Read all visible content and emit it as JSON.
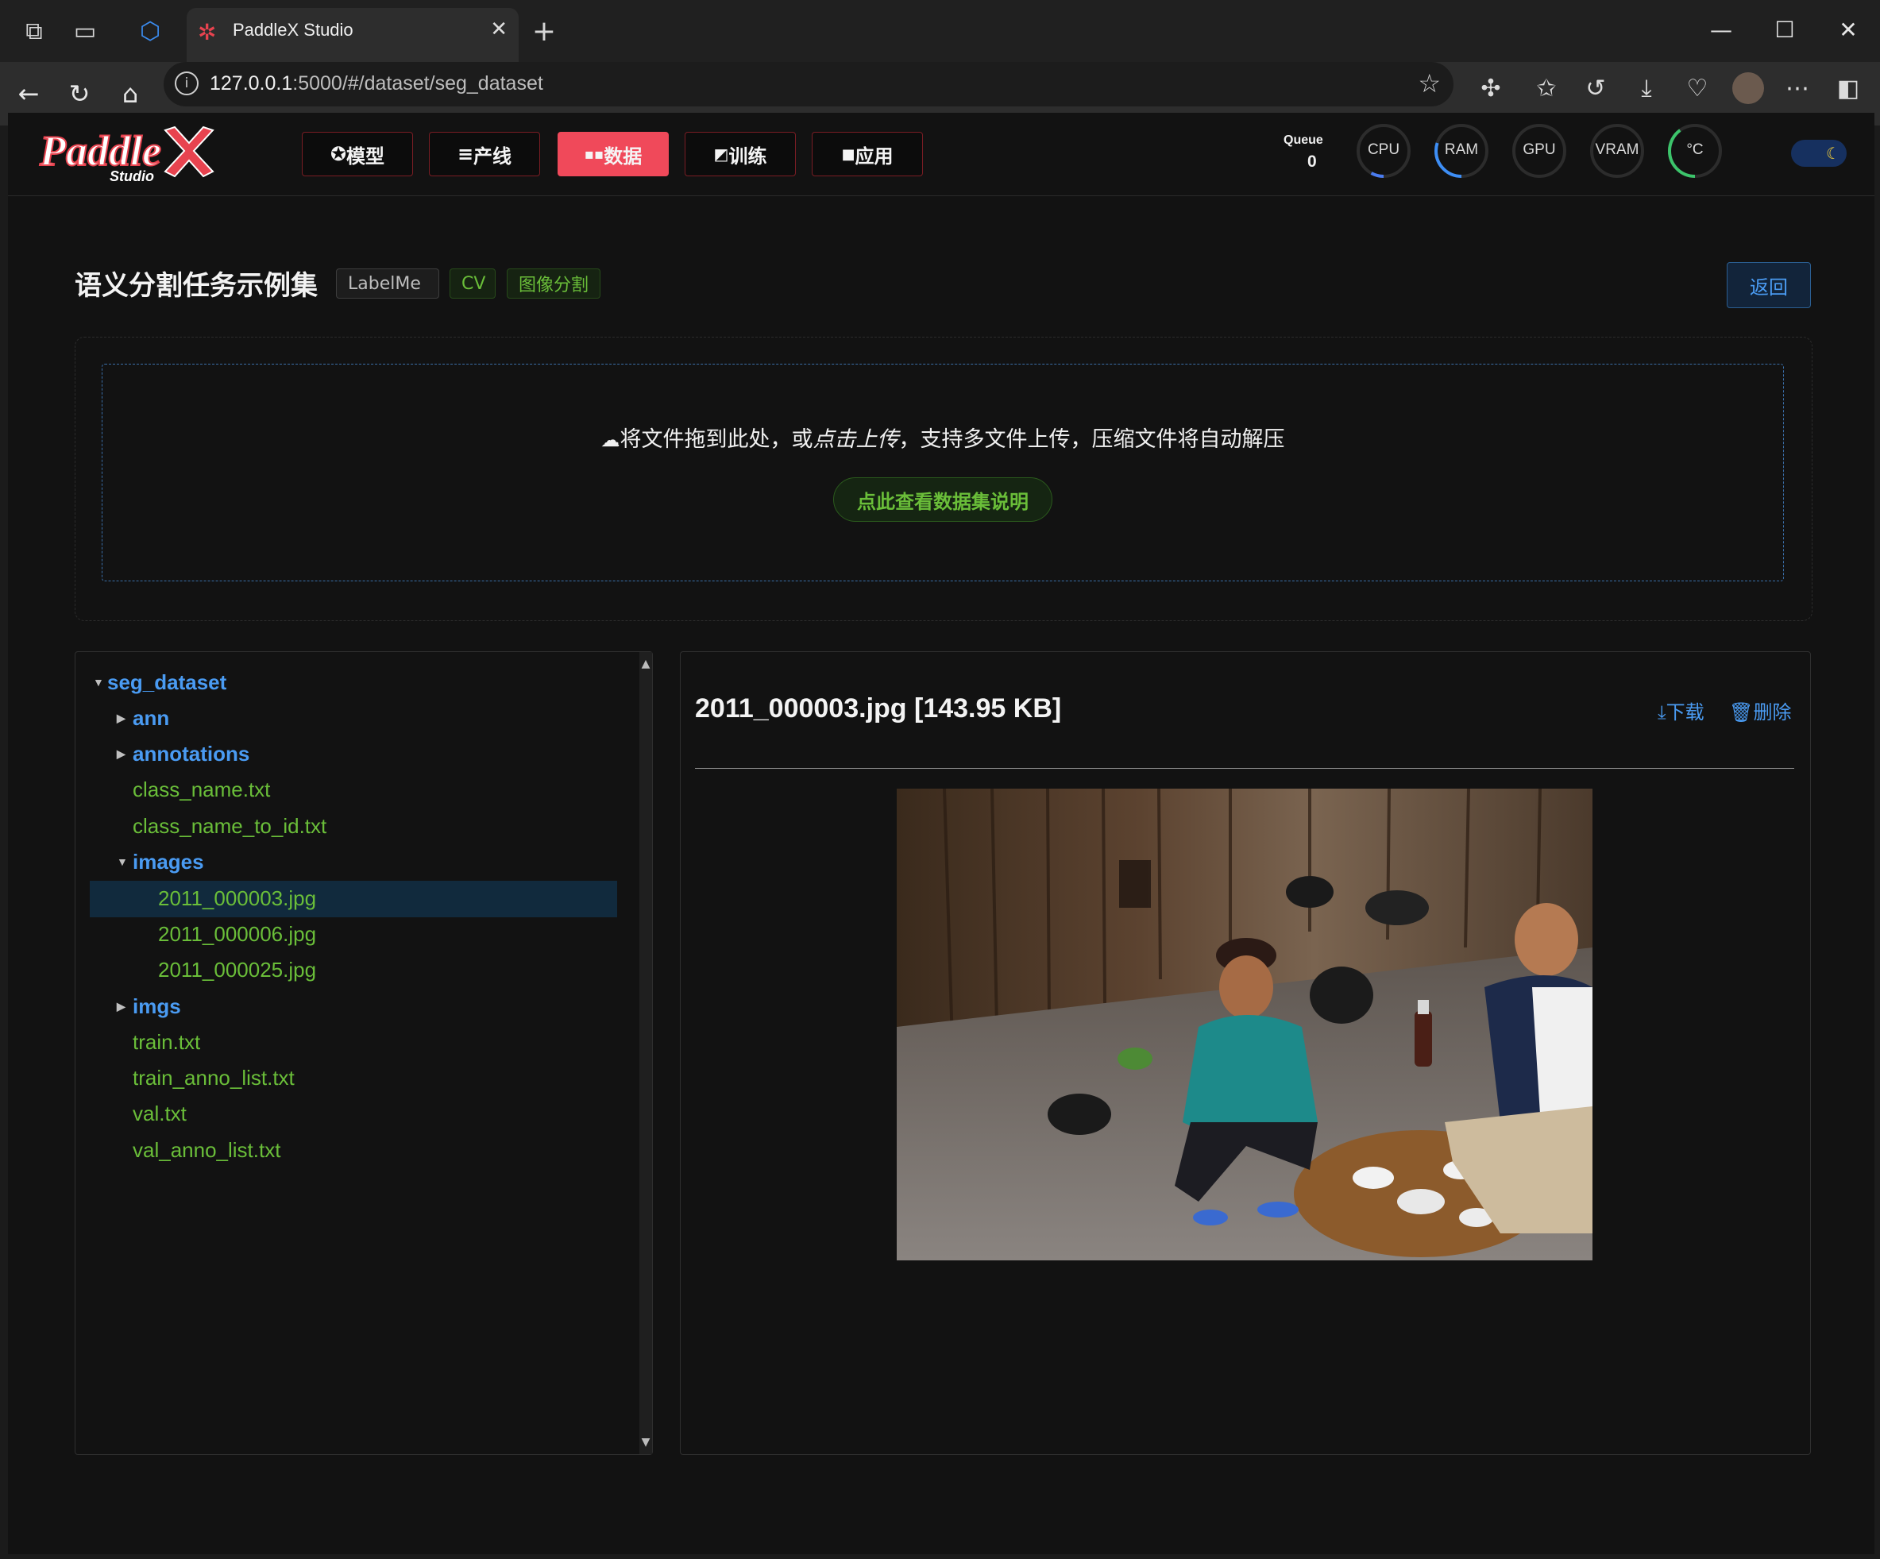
{
  "browser": {
    "tab_title": "PaddleX Studio",
    "url_host": "127.0.0.1",
    "url_path": ":5000/#/dataset/seg_dataset"
  },
  "nav": {
    "items": [
      {
        "icon": "✪",
        "label": "模型"
      },
      {
        "icon": "≡",
        "label": "产线"
      },
      {
        "icon": "▪▪",
        "label": "数据"
      },
      {
        "icon": "◩",
        "label": "训练"
      },
      {
        "icon": "■",
        "label": "应用"
      }
    ],
    "active": "数据"
  },
  "monitor": {
    "queue_label": "Queue",
    "queue_value": "0",
    "gauges": [
      {
        "label": "CPU",
        "level": 0.08,
        "color": "#4a7cf0"
      },
      {
        "label": "RAM",
        "level": 0.3,
        "color": "#3d8ef5"
      },
      {
        "label": "GPU",
        "level": 0.0,
        "color": "#4a4a4a"
      },
      {
        "label": "VRAM",
        "level": 0.0,
        "color": "#4a4a4a"
      },
      {
        "label": "°C",
        "level": 0.4,
        "color": "#3cc46b"
      }
    ]
  },
  "dataset": {
    "title": "语义分割任务示例集",
    "tags": [
      "LabelMe",
      "CV",
      "图像分割"
    ],
    "back_label": "返回",
    "upload_prefix": "将文件拖到此处，或",
    "upload_link": "点击上传",
    "upload_suffix": "，支持多文件上传，压缩文件将自动解压",
    "readme_label": "点此查看数据集说明"
  },
  "tree": {
    "items": [
      {
        "name": "seg_dataset",
        "type": "dir",
        "state": "open"
      },
      {
        "name": "ann",
        "type": "dir",
        "state": "closed"
      },
      {
        "name": "annotations",
        "type": "dir",
        "state": "closed"
      },
      {
        "name": "class_name.txt",
        "type": "file"
      },
      {
        "name": "class_name_to_id.txt",
        "type": "file"
      },
      {
        "name": "images",
        "type": "dir",
        "state": "open"
      },
      {
        "name": "2011_000003.jpg",
        "type": "file",
        "selected": true
      },
      {
        "name": "2011_000006.jpg",
        "type": "file"
      },
      {
        "name": "2011_000025.jpg",
        "type": "file"
      },
      {
        "name": "imgs",
        "type": "dir",
        "state": "closed"
      },
      {
        "name": "train.txt",
        "type": "file"
      },
      {
        "name": "train_anno_list.txt",
        "type": "file"
      },
      {
        "name": "val.txt",
        "type": "file"
      },
      {
        "name": "val_anno_list.txt",
        "type": "file"
      }
    ]
  },
  "preview": {
    "file_title": "2011_000003.jpg [143.95 KB]",
    "download_label": "下载",
    "delete_label": "删除"
  },
  "colors": {
    "accent_red": "#f0495a",
    "link_blue": "#4a9bf2",
    "file_green": "#6abe39"
  }
}
